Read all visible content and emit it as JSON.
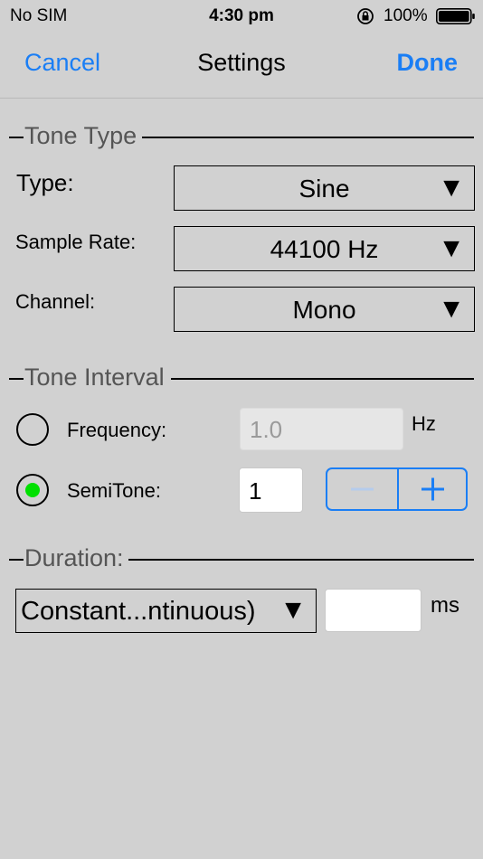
{
  "status_bar": {
    "carrier": "No SIM",
    "time": "4:30 pm",
    "battery": "100%"
  },
  "nav": {
    "cancel": "Cancel",
    "title": "Settings",
    "done": "Done"
  },
  "tone_type": {
    "header": "Tone Type",
    "type_label": "Type:",
    "type_value": "Sine",
    "sample_rate_label": "Sample Rate:",
    "sample_rate_value": "44100 Hz",
    "channel_label": "Channel:",
    "channel_value": "Mono"
  },
  "tone_interval": {
    "header": "Tone Interval",
    "frequency_label": "Frequency:",
    "frequency_value": "1.0",
    "frequency_unit": "Hz",
    "semitone_label": "SemiTone:",
    "semitone_value": "1",
    "selected": "semitone"
  },
  "duration": {
    "header": "Duration:",
    "mode_value": "Constant...ntinuous)",
    "ms_value": "",
    "ms_unit": "ms"
  },
  "dropdown_arrow": "▼",
  "colors": {
    "accent": "#1a7ef5",
    "background": "#d1d1d1",
    "radio_selected": "#00e000",
    "disabled_field": "#e6e6e6"
  }
}
